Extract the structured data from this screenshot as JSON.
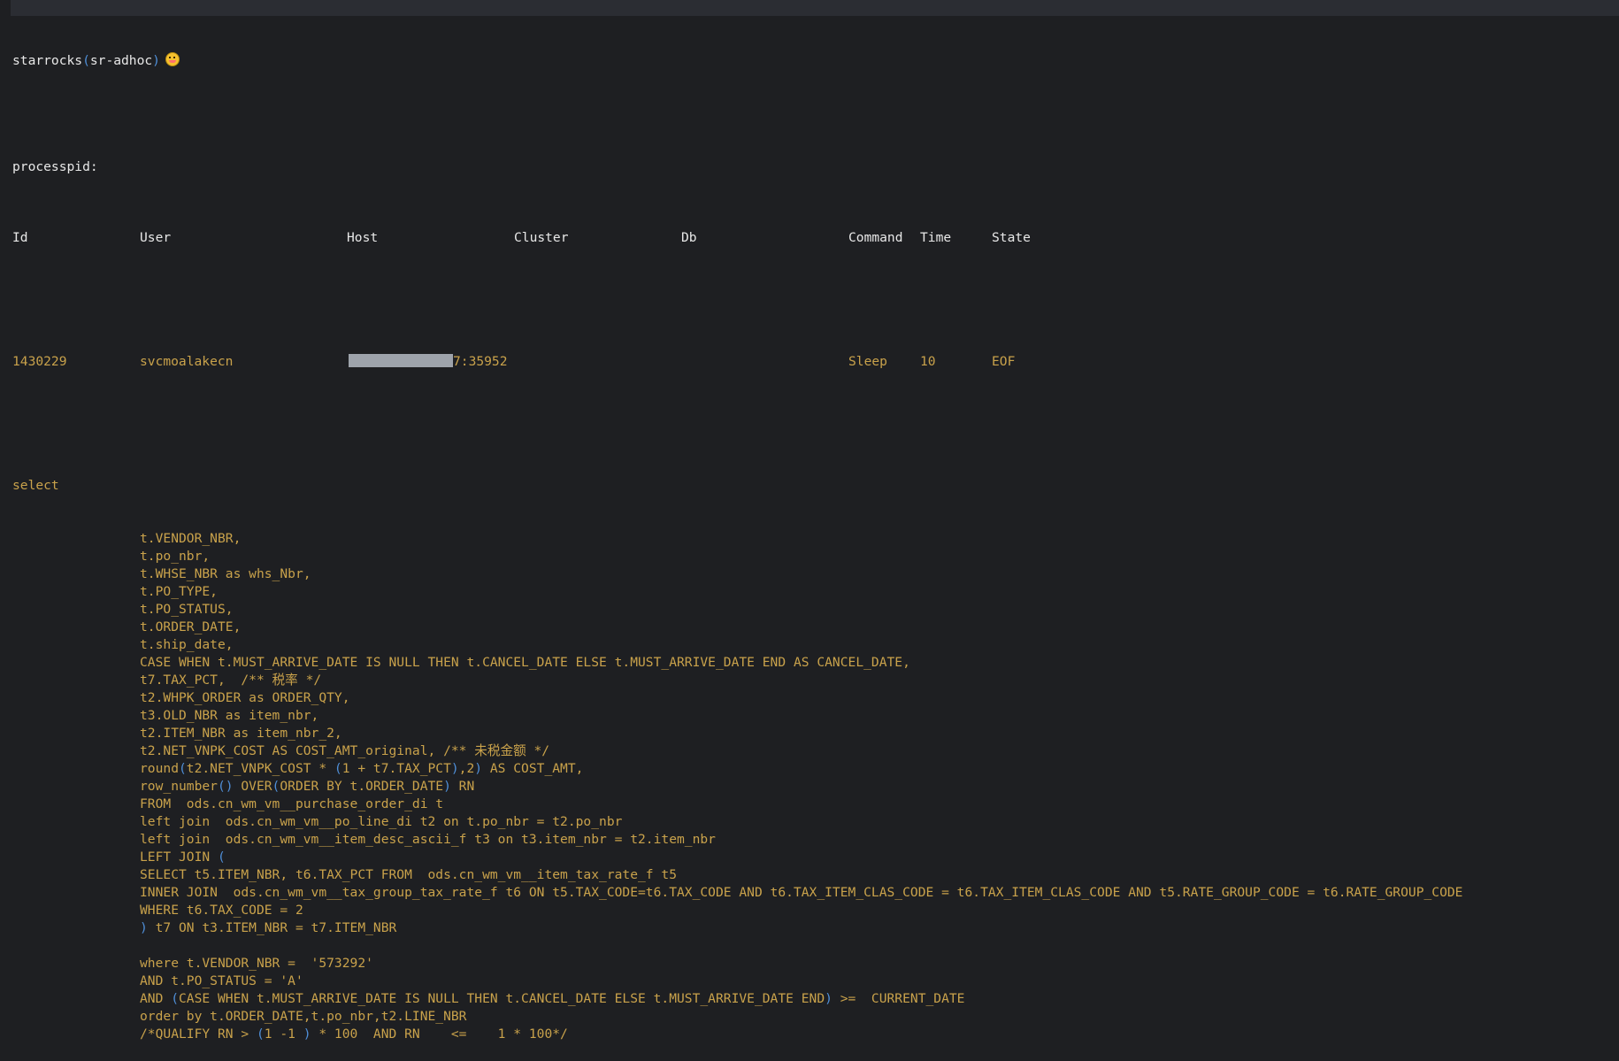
{
  "prompt": {
    "name": "starrocks",
    "open": "(",
    "context": "sr-adhoc",
    "close": ")",
    "emoji_icon": "grinning-face-with-tongue-icon"
  },
  "section_label": "processpid:",
  "columns": [
    "Id",
    "User",
    "Host",
    "Cluster",
    "Db",
    "Command",
    "Time",
    "State"
  ],
  "process": {
    "id": "1430229",
    "user": "svcmoalakecn",
    "host_visible_suffix": "7:35952",
    "cluster": "",
    "db": "",
    "command": "Sleep",
    "time": "10",
    "state": "EOF"
  },
  "sql": {
    "keyword": "select",
    "lines": [
      "t.VENDOR_NBR,",
      "t.po_nbr,",
      "t.WHSE_NBR as whs_Nbr,",
      "t.PO_TYPE,",
      "t.PO_STATUS,",
      "t.ORDER_DATE,",
      "t.ship_date,",
      "CASE WHEN t.MUST_ARRIVE_DATE IS NULL THEN t.CANCEL_DATE ELSE t.MUST_ARRIVE_DATE END AS CANCEL_DATE,",
      "t7.TAX_PCT,  /** 税率 */",
      "t2.WHPK_ORDER as ORDER_QTY,",
      "t3.OLD_NBR as item_nbr,",
      "t2.ITEM_NBR as item_nbr_2,",
      "t2.NET_VNPK_COST AS COST_AMT_original, /** 未税金额 */",
      "round(t2.NET_VNPK_COST * (1 + t7.TAX_PCT),2) AS COST_AMT,",
      "row_number() OVER(ORDER BY t.ORDER_DATE) RN",
      "FROM  ods.cn_wm_vm__purchase_order_di t",
      "left join  ods.cn_wm_vm__po_line_di t2 on t.po_nbr = t2.po_nbr",
      "left join  ods.cn_wm_vm__item_desc_ascii_f t3 on t3.item_nbr = t2.item_nbr",
      "LEFT JOIN (",
      "SELECT t5.ITEM_NBR, t6.TAX_PCT FROM  ods.cn_wm_vm__item_tax_rate_f t5",
      "INNER JOIN  ods.cn_wm_vm__tax_group_tax_rate_f t6 ON t5.TAX_CODE=t6.TAX_CODE AND t6.TAX_ITEM_CLAS_CODE = t6.TAX_ITEM_CLAS_CODE AND t5.RATE_GROUP_CODE = t6.RATE_GROUP_CODE",
      "WHERE t6.TAX_CODE = 2",
      ") t7 ON t3.ITEM_NBR = t7.ITEM_NBR",
      "",
      "where t.VENDOR_NBR =  '573292'",
      "AND t.PO_STATUS = 'A'",
      "AND (CASE WHEN t.MUST_ARRIVE_DATE IS NULL THEN t.CANCEL_DATE ELSE t.MUST_ARRIVE_DATE END) >=  CURRENT_DATE",
      "order by t.ORDER_DATE,t.po_nbr,t2.LINE_NBR",
      "/*QUALIFY RN > (1 -1 ) * 100  AND RN    <=    1 * 100*/"
    ]
  },
  "colors": {
    "background": "#1e1f22",
    "text": "#e8e8e8",
    "sql": "#c9a24b",
    "bracket": "#4f8fd8",
    "redaction": "#9ea3ab"
  }
}
